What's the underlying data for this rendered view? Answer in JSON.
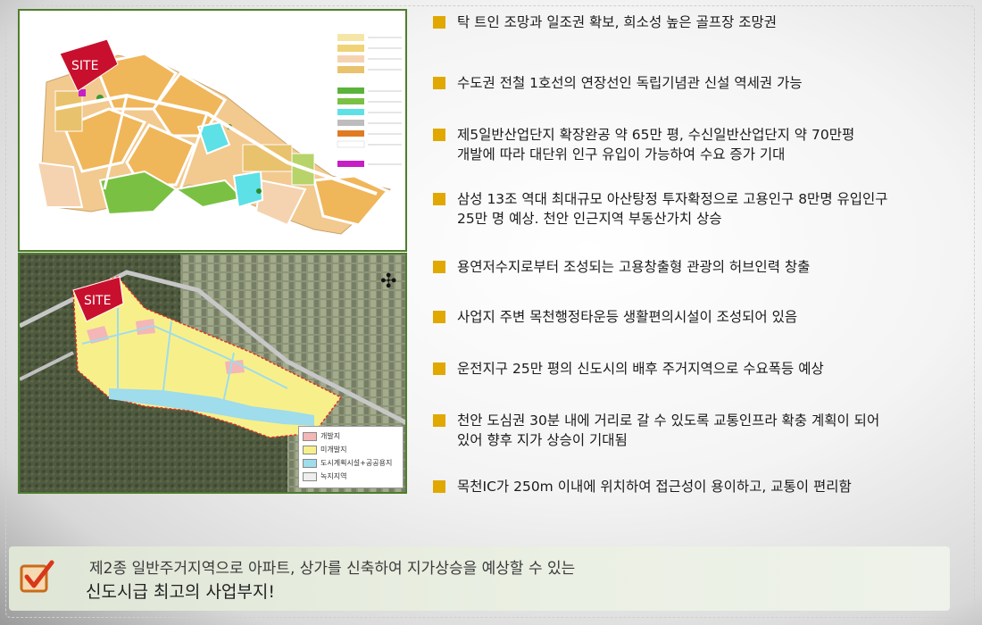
{
  "colors": {
    "bullet_square": "#e0a800",
    "panel_border": "#4e7d2c",
    "site_red": "#c8102e",
    "banner_bg": "#e5ebdd"
  },
  "map_top": {
    "site_label": "SITE"
  },
  "map_bottom": {
    "site_label": "SITE",
    "compass_icon": "compass-rose-icon",
    "legend": [
      {
        "label": "개발지",
        "color": "#f4b6b6"
      },
      {
        "label": "미개발지",
        "color": "#f7f08a"
      },
      {
        "label": "도시계획시설+공공용지",
        "color": "#9fdcec"
      },
      {
        "label": "녹지지역",
        "color": "#eeeeee"
      }
    ]
  },
  "bullets": [
    {
      "text": "탁 트인 조망과 일조권 확보, 희소성 높은 골프장 조망권"
    },
    {
      "text": "수도권 전철 1호선의 연장선인 독립기념관 신설 역세권 가능"
    },
    {
      "text": "제5일반산업단지 확장완공 약 65만 평, 수신일반산업단지 약 70만평\n개발에 따라 대단위 인구 유입이 가능하여 수요 증가 기대"
    },
    {
      "text": "삼성 13조 역대 최대규모 아산탕정 투자확정으로 고용인구 8만명 유입인구\n25만 명 예상. 천안 인근지역 부동산가치 상승"
    },
    {
      "text": "용연저수지로부터 조성되는 고용창출형 관광의 허브인력 창출"
    },
    {
      "text": "사업지 주변 목천행정타운등 생활편의시설이 조성되어 있음"
    },
    {
      "text": "운전지구 25만 평의 신도시의 배후 주거지역으로 수요폭등 예상"
    },
    {
      "text": "천안 도심권 30분 내에 거리로 갈 수 있도록 교통인프라 확충 계획이 되어\n있어 향후 지가 상승이 기대됨"
    },
    {
      "text": "목천IC가 250m 이내에 위치하여 접근성이 용이하고, 교통이 편리함"
    }
  ],
  "banner": {
    "icon": "checkbox-check-icon",
    "line1": "제2종 일반주거지역으로 아파트, 상가를 신축하여 지가상승을 예상할 수 있는",
    "line2": "신도시급 최고의 사업부지!"
  }
}
